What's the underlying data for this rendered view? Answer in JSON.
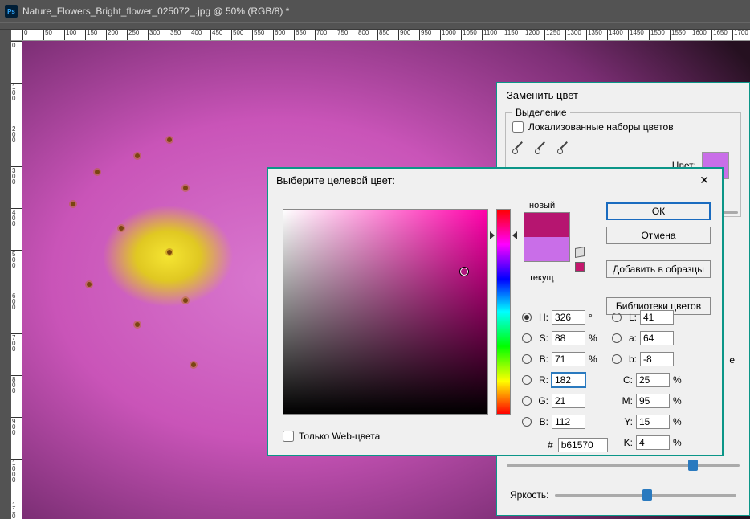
{
  "window": {
    "title": "Nature_Flowers_Bright_flower_025072_.jpg @ 50% (RGB/8) *"
  },
  "ruler_h": [
    "0",
    "50",
    "100",
    "150",
    "200",
    "250",
    "300",
    "350",
    "400",
    "450",
    "500",
    "550",
    "600",
    "650",
    "700",
    "750",
    "800",
    "850",
    "900",
    "950",
    "1000",
    "1050",
    "1100",
    "1150",
    "1200",
    "1250",
    "1300",
    "1350",
    "1400",
    "1450",
    "1500",
    "1550",
    "1600",
    "1650",
    "1700"
  ],
  "ruler_v": [
    "0",
    "100",
    "200",
    "300",
    "400",
    "500",
    "600",
    "700",
    "800",
    "900",
    "1000",
    "1100"
  ],
  "replace_color": {
    "title": "Заменить цвет",
    "selection_legend": "Выделение",
    "localized_clusters": "Локализованные наборы цветов",
    "color_label": "Цвет:",
    "brightness_label": "Яркость:"
  },
  "picker": {
    "title": "Выберите целевой цвет:",
    "new_label": "новый",
    "current_label": "текущ",
    "ok": "ОК",
    "cancel": "Отмена",
    "add_swatch": "Добавить в образцы",
    "libraries": "Библиотеки цветов",
    "web_only": "Только Web-цвета",
    "hsb": {
      "H": "326",
      "S": "88",
      "B": "71"
    },
    "lab": {
      "L": "41",
      "a": "64",
      "b": "-8"
    },
    "rgb": {
      "R": "182",
      "G": "21",
      "B": "112"
    },
    "cmyk": {
      "C": "25",
      "M": "95",
      "Y": "15",
      "K": "4"
    },
    "hex": "b61570",
    "labels": {
      "H": "H:",
      "S": "S:",
      "Bhsb": "B:",
      "L": "L:",
      "a": "a:",
      "blab": "b:",
      "R": "R:",
      "G": "G:",
      "Brgb": "B:",
      "C": "C:",
      "M": "M:",
      "Y": "Y:",
      "K": "K:",
      "deg": "°",
      "pct": "%",
      "hash": "#"
    }
  }
}
